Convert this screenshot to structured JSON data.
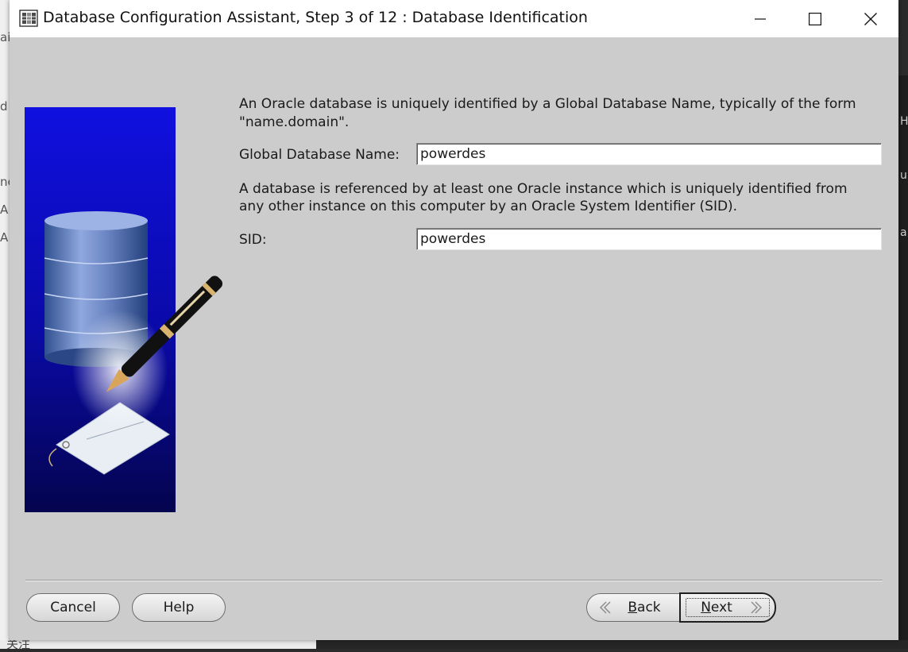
{
  "window": {
    "title": "Database Configuration Assistant, Step 3 of 12 : Database Identification",
    "icon": "database-app-icon"
  },
  "content": {
    "intro_text_line1": "An Oracle database is uniquely identified by a Global Database Name, typically of the form",
    "intro_text_line2": "\"name.domain\".",
    "global_db_name_label": "Global Database Name:",
    "global_db_name_value": "powerdes",
    "sid_text_line1": "A database is referenced by at least one Oracle instance which is uniquely identified from",
    "sid_text_line2": "any other instance on this computer by an Oracle System Identifier (SID).",
    "sid_label": "SID:",
    "sid_value": "powerdes"
  },
  "buttons": {
    "cancel": "Cancel",
    "help": "Help",
    "back_prefix": "",
    "back_mnemonic": "B",
    "back_rest": "ack",
    "next_mnemonic": "N",
    "next_rest": "ext"
  },
  "background": {
    "left_fragments": [
      "ai",
      "d",
      "ne",
      "A",
      "A"
    ],
    "right_fragments": [
      "H",
      "un",
      "a"
    ],
    "bottom_fragment": "关注"
  },
  "colors": {
    "banner_top": "#0a0ad0",
    "banner_bottom": "#05055a",
    "dialog_bg": "#cccccc"
  }
}
